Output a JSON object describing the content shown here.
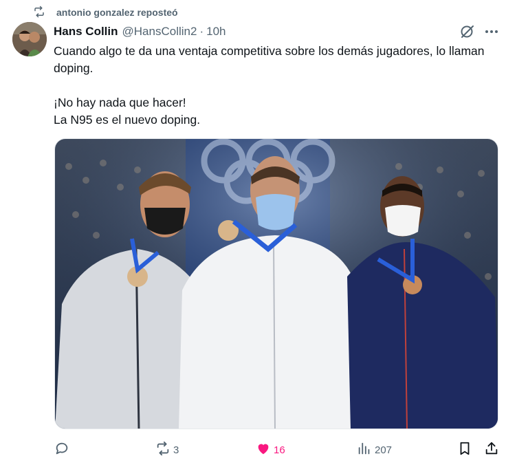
{
  "repost": {
    "text": "antonio gonzalez reposteó"
  },
  "author": {
    "name": "Hans Collin",
    "handle": "@HansCollin2",
    "separator": "·",
    "time": "10h"
  },
  "tweet": {
    "paragraphs": [
      "Cuando algo te da una ventaja competitiva sobre los demás jugadores, lo llaman doping.",
      "¡No hay nada que hacer!\nLa N95 es el nuevo doping."
    ]
  },
  "actions": {
    "reply": {
      "icon": "reply-icon",
      "count": ""
    },
    "retweet": {
      "icon": "retweet-icon",
      "count": "3"
    },
    "like": {
      "icon": "heart-icon",
      "count": "16",
      "active": true,
      "color": "#f91880"
    },
    "views": {
      "icon": "analytics-icon",
      "count": "207"
    },
    "bookmark": {
      "icon": "bookmark-icon"
    },
    "share": {
      "icon": "share-icon"
    }
  },
  "media": {
    "type": "photo",
    "description_icon": "photo-three-medalists"
  },
  "colors": {
    "text": "#0f1419",
    "secondary": "#536471",
    "like": "#f91880",
    "border": "#e6e9ec"
  }
}
